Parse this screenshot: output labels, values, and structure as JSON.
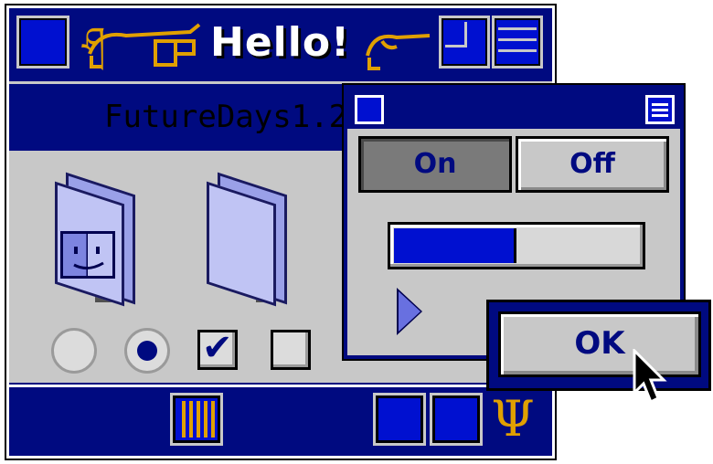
{
  "main_window": {
    "title": "Hello!",
    "ornament_left": "ཤ",
    "ornament_right": "ཤ",
    "subtitle": "FutureDays1.2",
    "radios": [
      {
        "checked": false
      },
      {
        "checked": true
      }
    ],
    "checkboxes": [
      {
        "checked": true,
        "mark": "✔"
      },
      {
        "checked": false,
        "mark": ""
      }
    ],
    "icons": [
      "finder-folder-icon",
      "folder-icon",
      "grid-icon",
      "trident-icon"
    ],
    "trident_glyph": "Ψ"
  },
  "control_window": {
    "on_label": "On",
    "off_label": "Off",
    "selected": "On",
    "progress": 0.5
  },
  "dialog": {
    "ok_label": "OK"
  },
  "colors": {
    "navy": "#000a80",
    "blue": "#0010d0",
    "gray": "#c8c8c8",
    "gold": "#e0a000",
    "lavender": "#c0c4f4"
  }
}
